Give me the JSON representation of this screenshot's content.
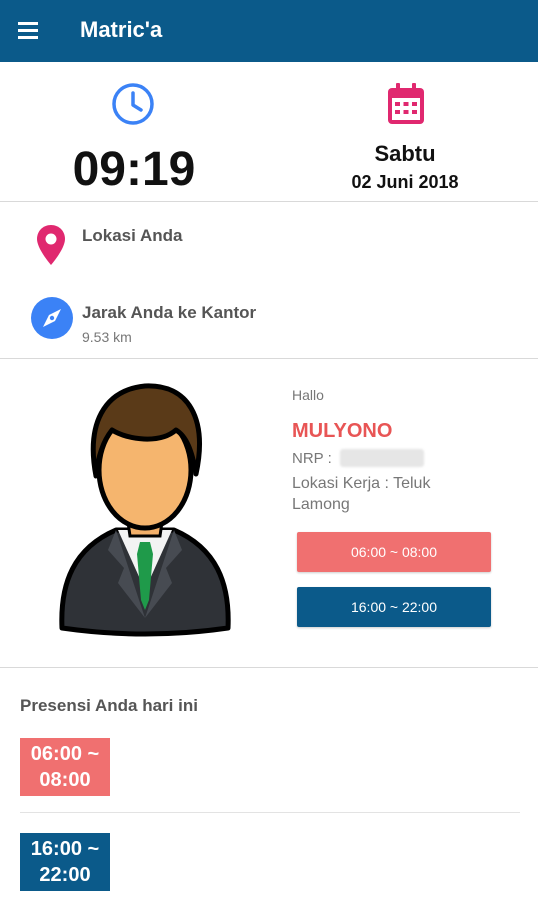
{
  "appbar": {
    "title": "Matric'a",
    "menu_icon": "hamburger-menu-icon"
  },
  "clock": {
    "icon": "clock-icon",
    "time": "09:19",
    "color": "#3b82f6"
  },
  "calendar": {
    "icon": "calendar-icon",
    "day": "Sabtu",
    "date": "02 Juni 2018",
    "color": "#e0286f"
  },
  "location": {
    "icon": "location-pin-icon",
    "label": "Lokasi Anda"
  },
  "distance": {
    "icon": "compass-icon",
    "label": "Jarak Anda ke Kantor",
    "value": "9.53 km"
  },
  "profile": {
    "greeting": "Hallo",
    "name": "MULYONO",
    "nrp_label": "NRP :",
    "lokasi_kerja": "Lokasi Kerja : Teluk Lamong"
  },
  "shifts": [
    {
      "label": "06:00 ~ 08:00",
      "color": "#f07070"
    },
    {
      "label": "16:00 ~ 22:00",
      "color": "#0b5a8a"
    }
  ],
  "presensi": {
    "title": "Presensi Anda hari ini",
    "items": [
      {
        "line1": "06:00 ~",
        "line2": "08:00"
      },
      {
        "line1": "16:00 ~",
        "line2": "22:00"
      }
    ]
  }
}
